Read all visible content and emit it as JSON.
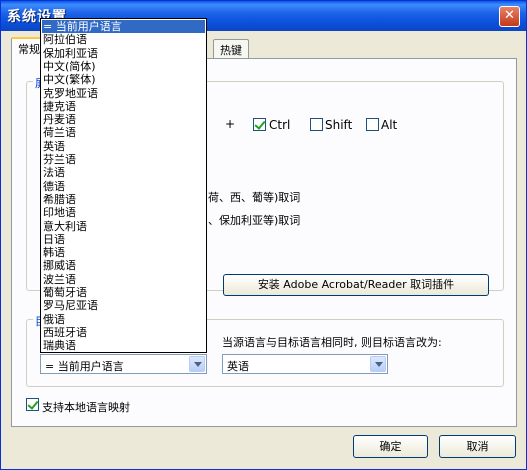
{
  "window": {
    "title": "系统设置",
    "close_glyph": "✕"
  },
  "tabs": [
    "常规",
    "热键"
  ],
  "group_title_1": "屏",
  "group_title_2": "目",
  "hotkey": {
    "plus": "+",
    "ctrl": "Ctrl",
    "shift": "Shift",
    "alt": "Alt",
    "ctrl_checked": true,
    "shift_checked": false,
    "alt_checked": false
  },
  "line_1": "荷、西、葡等)取词",
  "line_2": "、保加利亚等)取词",
  "plugin_button": "安装 Adobe Acrobat/Reader 取词插件",
  "same_lang_label": "当源语言与目标语言相同时, 则目标语言改为:",
  "source_combo": "= 当前用户语言",
  "target_combo": "英语",
  "local_mapping": {
    "label": "支持本地语言映射",
    "checked": true
  },
  "ok_button": "确定",
  "cancel_button": "取消",
  "dropdown_items": [
    "= 当前用户语言",
    "阿拉伯语",
    "保加利亚语",
    "中文(简体)",
    "中文(繁体)",
    "克罗地亚语",
    "捷克语",
    "丹麦语",
    "荷兰语",
    "英语",
    "芬兰语",
    "法语",
    "德语",
    "希腊语",
    "印地语",
    "意大利语",
    "日语",
    "韩语",
    "挪威语",
    "波兰语",
    "葡萄牙语",
    "罗马尼亚语",
    "俄语",
    "西班牙语",
    "瑞典语"
  ],
  "dropdown_selected_index": 0
}
